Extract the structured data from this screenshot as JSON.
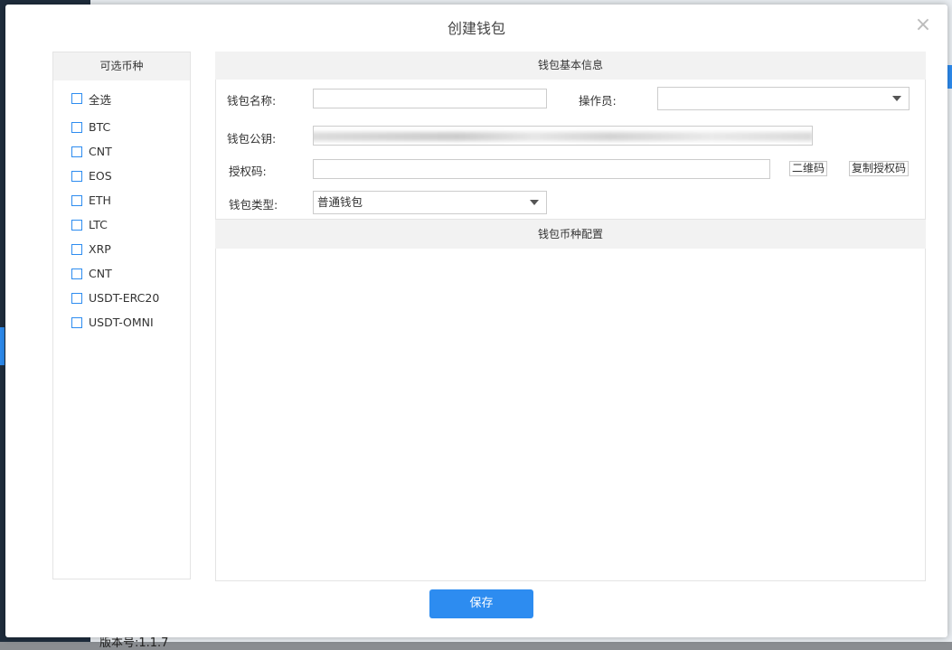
{
  "modal": {
    "title": "创建钱包",
    "close_glyph": "×",
    "save_label": "保存"
  },
  "coin_panel": {
    "header": "可选币种",
    "select_all_label": "全选",
    "items": [
      "BTC",
      "CNT",
      "EOS",
      "ETH",
      "LTC",
      "XRP",
      "CNT",
      "USDT-ERC20",
      "USDT-OMNI"
    ]
  },
  "basic_info": {
    "header": "钱包基本信息",
    "name_label": "钱包名称:",
    "name_value": "",
    "operator_label": "操作员:",
    "operator_value": "",
    "pubkey_label": "钱包公钥:",
    "auth_code_label": "授权码:",
    "auth_code_value": "",
    "qr_button_label": "二维码",
    "copy_button_label": "复制授权码",
    "type_label": "钱包类型:",
    "type_value": "普通钱包"
  },
  "coin_config": {
    "header": "钱包币种配置"
  },
  "background": {
    "footer_text": "版本号:1.1.7"
  },
  "colors": {
    "accent": "#2d8cf0",
    "sidebar_bg": "#1f2d3d",
    "panel_header_bg": "#f2f2f2"
  },
  "icons": {
    "close": "close-icon",
    "dropdown": "chevron-down-icon",
    "checkbox": "checkbox-icon"
  }
}
